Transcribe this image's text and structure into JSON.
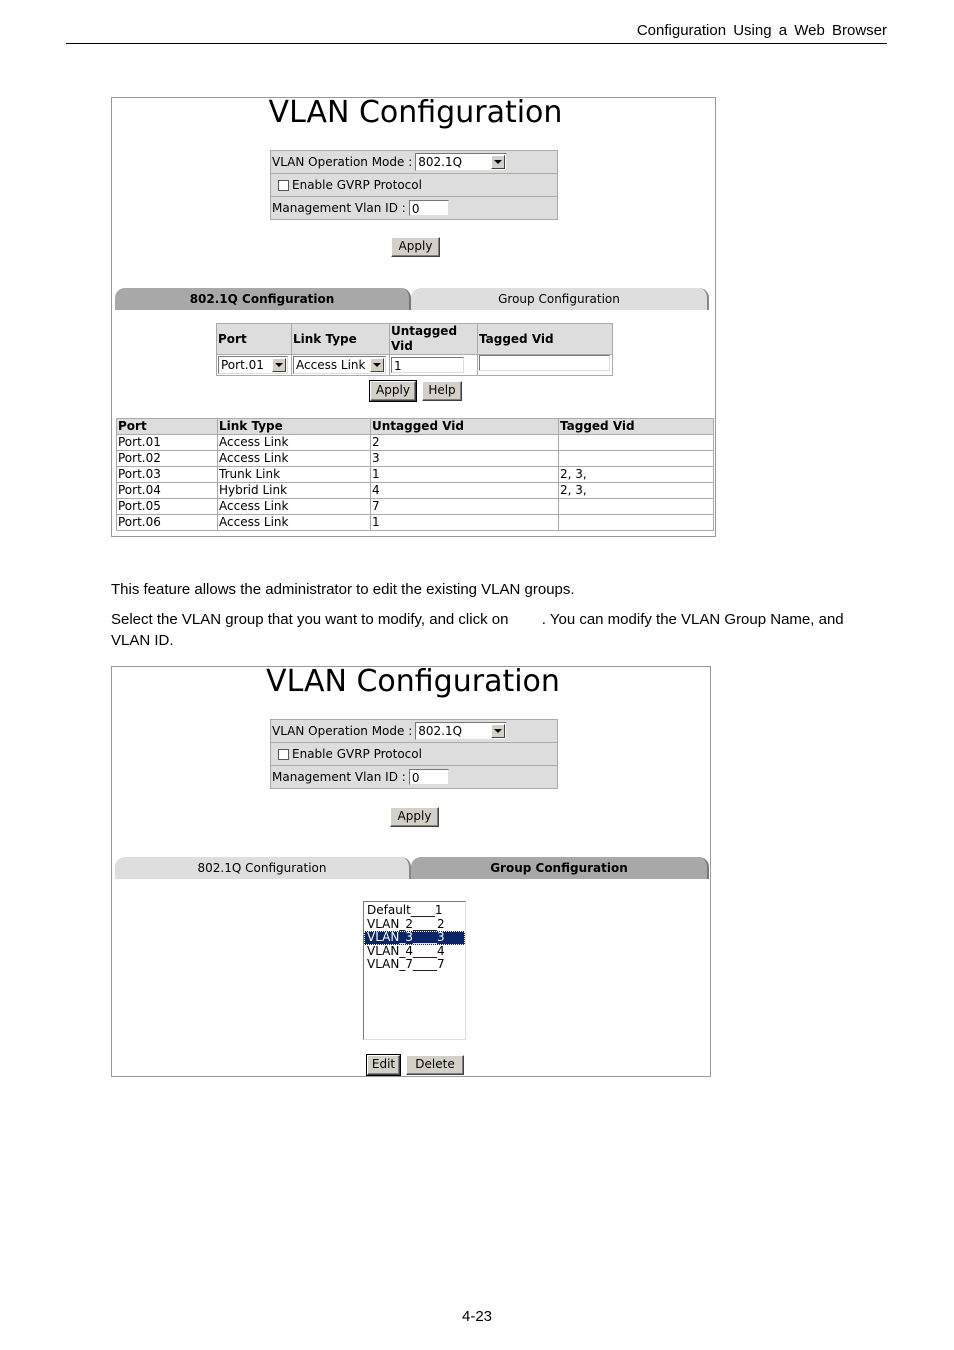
{
  "page": {
    "running_header": "Configuration Using a Web Browser",
    "page_number": "4-23",
    "paragraph1": "This feature allows the administrator to edit the existing VLAN groups.",
    "paragraph2": "Select the VLAN group that you want to modify, and click on        . You can modify the VLAN Group Name, and VLAN ID."
  },
  "screenshot1": {
    "title": "VLAN Configuration",
    "operation_mode_label": "VLAN Operation Mode :",
    "operation_mode_value": "802.1Q",
    "gvrp_label": "Enable GVRP Protocol",
    "gvrp_checked": false,
    "mgmt_vlan_label": "Management Vlan ID :",
    "mgmt_vlan_value": "0",
    "apply_label": "Apply",
    "tabs": [
      {
        "label": "802.1Q Configuration",
        "active": true
      },
      {
        "label": "Group Configuration",
        "active": false
      }
    ],
    "config_table": {
      "headers": [
        "Port",
        "Link Type",
        "Untagged Vid",
        "Tagged Vid"
      ],
      "port_value": "Port.01",
      "link_type_value": "Access Link",
      "untagged_value": "1",
      "tagged_value": ""
    },
    "apply2_label": "Apply",
    "help_label": "Help",
    "port_table": {
      "headers": [
        "Port",
        "Link Type",
        "Untagged Vid",
        "Tagged Vid"
      ],
      "rows": [
        [
          "Port.01",
          "Access Link",
          "2",
          ""
        ],
        [
          "Port.02",
          "Access Link",
          "3",
          ""
        ],
        [
          "Port.03",
          "Trunk Link",
          "1",
          "2, 3,"
        ],
        [
          "Port.04",
          "Hybrid Link",
          "4",
          "2, 3,"
        ],
        [
          "Port.05",
          "Access Link",
          "7",
          ""
        ],
        [
          "Port.06",
          "Access Link",
          "1",
          ""
        ]
      ]
    }
  },
  "screenshot2": {
    "title": "VLAN Configuration",
    "operation_mode_label": "VLAN Operation Mode :",
    "operation_mode_value": "802.1Q",
    "gvrp_label": "Enable GVRP Protocol",
    "gvrp_checked": false,
    "mgmt_vlan_label": "Management Vlan ID :",
    "mgmt_vlan_value": "0",
    "apply_label": "Apply",
    "tabs": [
      {
        "label": "802.1Q Configuration",
        "active": false
      },
      {
        "label": "Group Configuration",
        "active": true
      }
    ],
    "vlan_groups": [
      {
        "label": "Default____1",
        "selected": false
      },
      {
        "label": "VLAN_2____2",
        "selected": false
      },
      {
        "label": "VLAN_3____3",
        "selected": true
      },
      {
        "label": "VLAN_4____4",
        "selected": false
      },
      {
        "label": "VLAN_7____7",
        "selected": false
      }
    ],
    "edit_label": "Edit",
    "delete_label": "Delete"
  }
}
